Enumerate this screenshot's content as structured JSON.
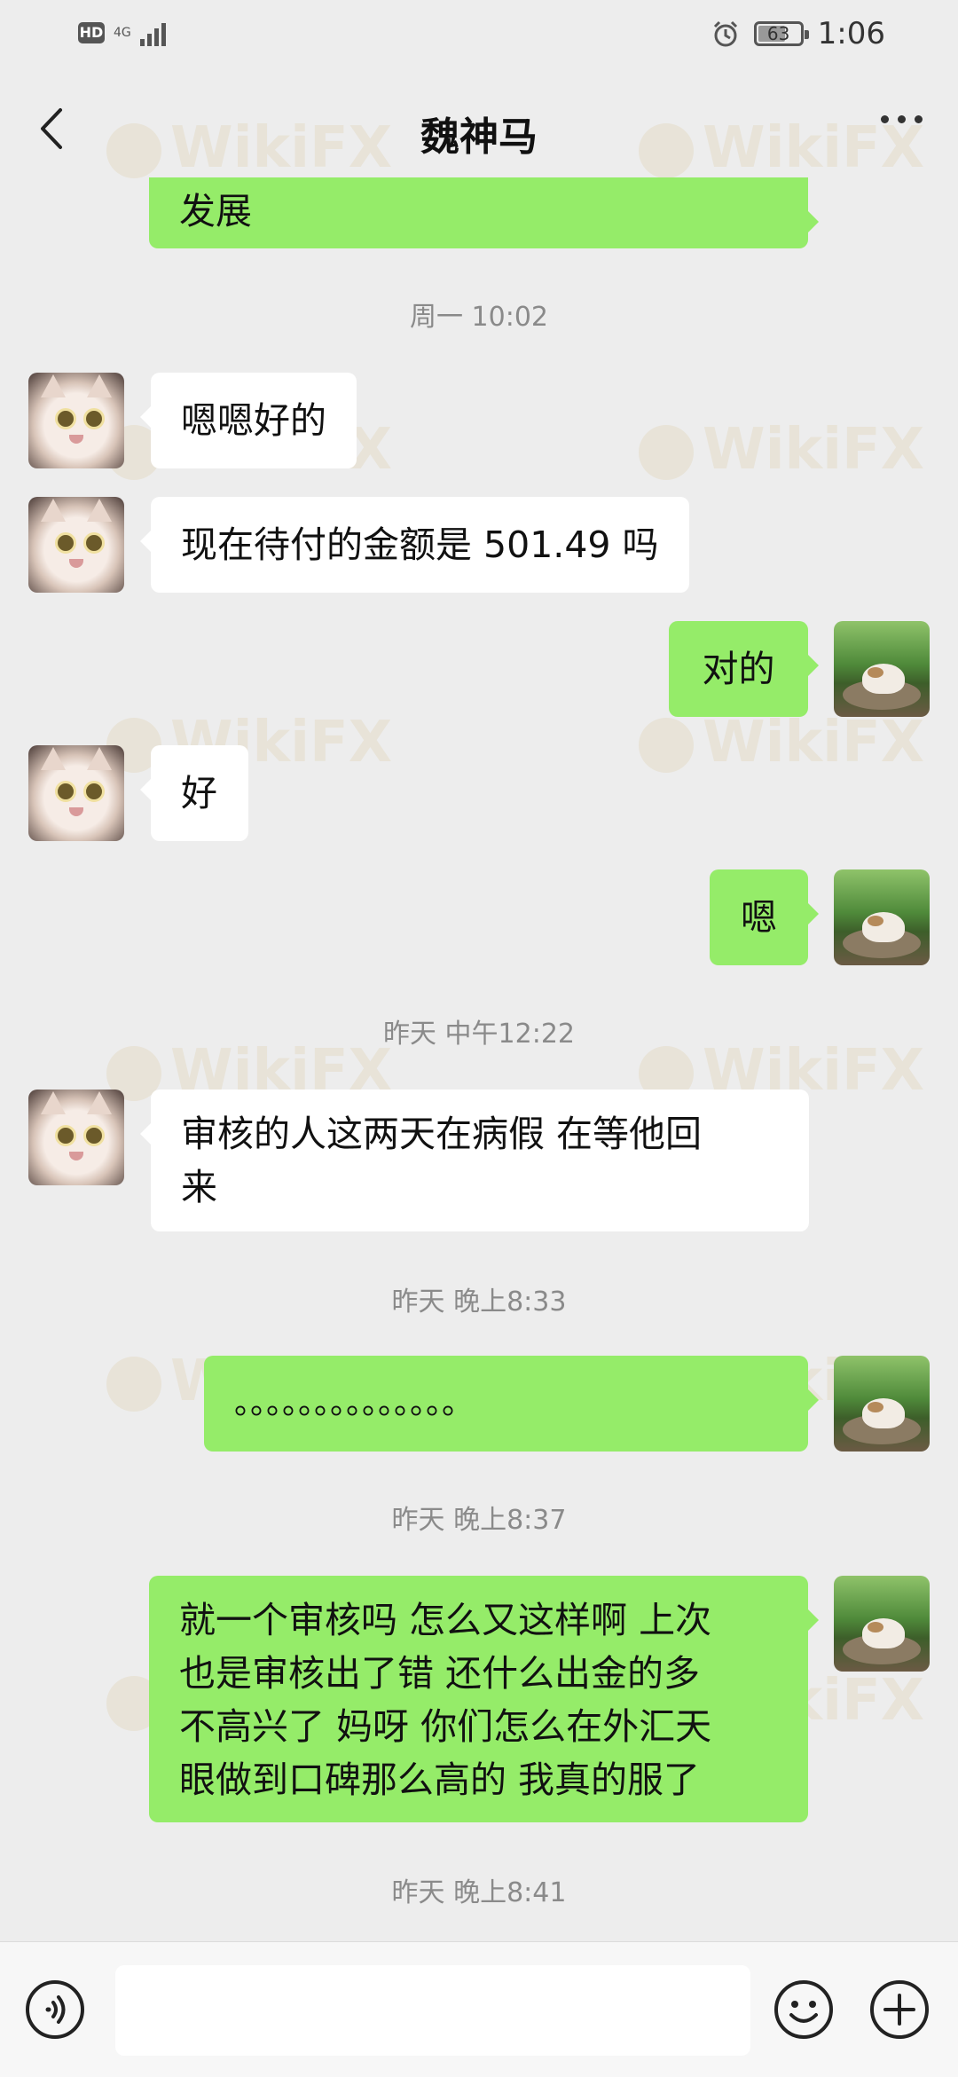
{
  "status_bar": {
    "hd": "HD",
    "network": "4G",
    "battery": "63",
    "time": "1:06"
  },
  "header": {
    "title": "魏神马"
  },
  "messages": [
    {
      "side": "out",
      "text": "发展"
    },
    {
      "type": "timestamp",
      "text": "周一 10:02"
    },
    {
      "side": "in",
      "text": "嗯嗯好的"
    },
    {
      "side": "in",
      "text": "现在待付的金额是 501.49 吗"
    },
    {
      "side": "out",
      "text": "对的"
    },
    {
      "side": "in",
      "text": "好"
    },
    {
      "side": "out",
      "text": "嗯"
    },
    {
      "type": "timestamp",
      "text": "昨天 中午12:22"
    },
    {
      "side": "in",
      "lines": [
        "审核的人这两天在病假 在等他回",
        "来"
      ]
    },
    {
      "type": "timestamp",
      "text": "昨天 晚上8:33"
    },
    {
      "side": "out",
      "text": "。。。。。。。。。。。。。。"
    },
    {
      "type": "timestamp",
      "text": "昨天 晚上8:37"
    },
    {
      "side": "out",
      "lines": [
        "就一个审核吗 怎么又这样啊 上次",
        "也是审核出了错 还什么出金的多",
        "不高兴了  妈呀 你们怎么在外汇天",
        "眼做到口碑那么高的 我真的服了"
      ]
    },
    {
      "type": "timestamp",
      "text": "昨天 晚上8:41"
    }
  ],
  "watermark": "WikiFX",
  "composer": {
    "placeholder": ""
  }
}
